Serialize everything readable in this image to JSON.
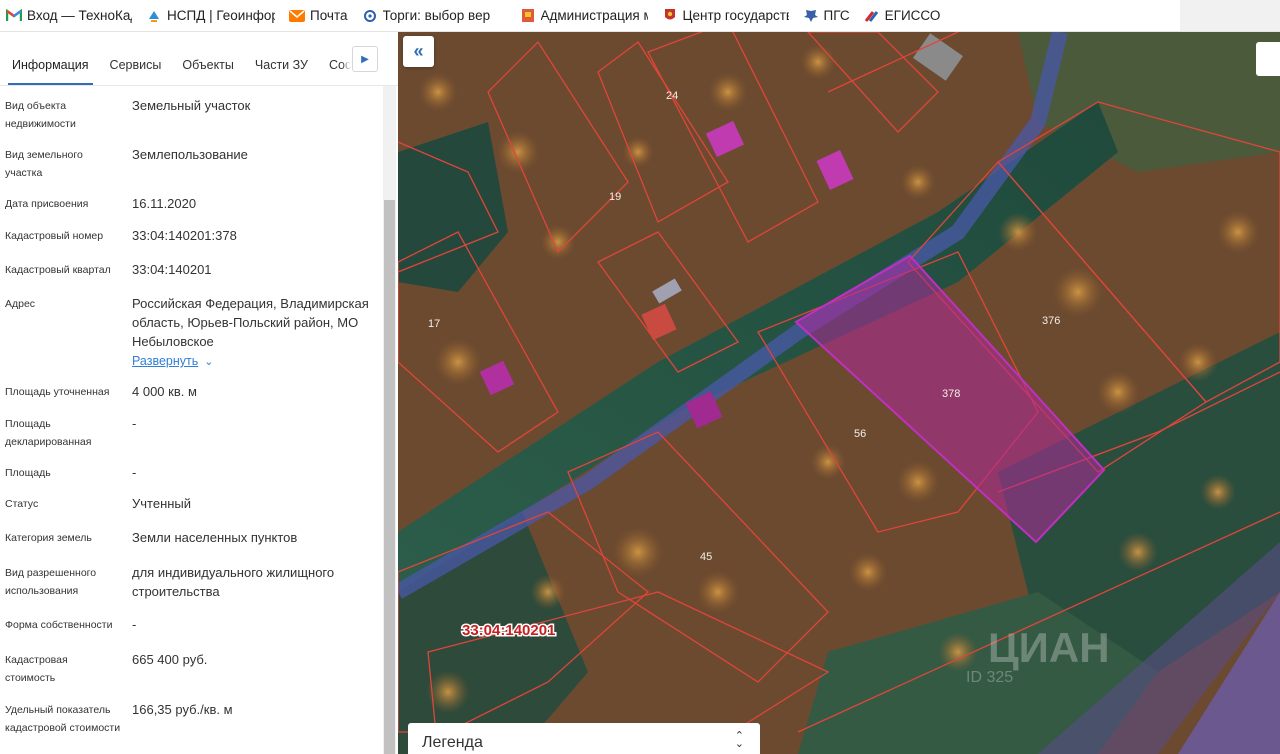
{
  "bookmarks": [
    {
      "icon": "gmail-icon",
      "label": "Вход — ТехноКад"
    },
    {
      "icon": "nspd-icon",
      "label": "НСПД | Геоинфор"
    },
    {
      "icon": "mail-icon",
      "label": "Почта"
    },
    {
      "icon": "torgi-icon",
      "label": "Торги: выбор вер"
    },
    {
      "icon": "administration-icon",
      "label": "Администрация м"
    },
    {
      "icon": "emblem-icon",
      "label": "Центр государств"
    },
    {
      "icon": "pgs-icon",
      "label": "ПГС"
    },
    {
      "icon": "egisso-icon",
      "label": "ЕГИССО"
    }
  ],
  "tabs": [
    "Информация",
    "Сервисы",
    "Объекты",
    "Части ЗУ",
    "Сост"
  ],
  "tab_next_icon": "chevron-right-icon",
  "info": {
    "object_type": {
      "label": "Вид объекта недвижимости",
      "value": "Земельный участок"
    },
    "land_type": {
      "label": "Вид земельного участка",
      "value": "Землепользование"
    },
    "assign_date": {
      "label": "Дата присвоения",
      "value": "16.11.2020"
    },
    "cadastral_number": {
      "label": "Кадастровый номер",
      "value": "33:04:140201:378"
    },
    "cadastral_quarter": {
      "label": "Кадастровый квартал",
      "value": "33:04:140201"
    },
    "address": {
      "label": "Адрес",
      "value": "Российская Федерация, Владимирская область, Юрьев-Польский район, МО Небыловское",
      "expand": "Развернуть"
    },
    "area_refined": {
      "label": "Площадь уточненная",
      "value": "4 000 кв. м"
    },
    "area_declared": {
      "label": "Площадь декларированная",
      "value": "-"
    },
    "area": {
      "label": "Площадь",
      "value": "-"
    },
    "status": {
      "label": "Статус",
      "value": "Учтенный"
    },
    "land_category": {
      "label": "Категория земель",
      "value": "Земли населенных пунктов"
    },
    "permitted_use": {
      "label": "Вид разрешенного использования",
      "value": "для индивидуального жилищного строительства"
    },
    "ownership_form": {
      "label": "Форма собственности",
      "value": "-"
    },
    "cadastral_value": {
      "label": "Кадастровая стоимость",
      "value": "665 400 руб."
    },
    "specific_value": {
      "label": "Удельный показатель кадастровой стоимости",
      "value": "166,35 руб./кв. м"
    }
  },
  "map": {
    "collapse_icon": "double-chevron-left-icon",
    "quarter_label": "33:04:140201",
    "parcel_numbers": [
      "24",
      "19",
      "17",
      "376",
      "378",
      "56",
      "45"
    ],
    "watermark": "ЦИАН",
    "watermark_id": "ID 325",
    "legend_label": "Легенда",
    "legend_toggle_icon": "up-down-chevron-icon",
    "colors": {
      "parcel_outline": "#e0453a",
      "selected_parcel_fill": "#b0289a",
      "selected_parcel_outline": "#c030c0",
      "quarter_label": "#c81e1e",
      "road": "#4a58a8"
    }
  }
}
